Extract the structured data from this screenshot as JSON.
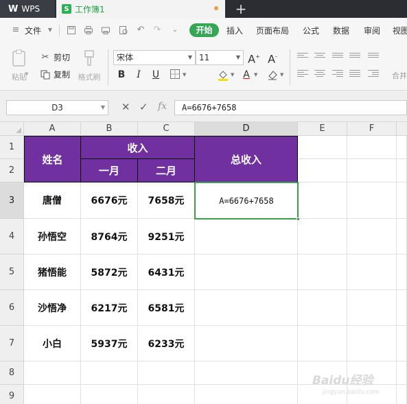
{
  "tabs": {
    "wps_label": "WPS",
    "wps_logo": "W",
    "doc_icon": "S",
    "doc_title": "工作簿1",
    "new_tab": "+"
  },
  "menu": {
    "file": "文件",
    "start": "开始",
    "insert": "插入",
    "page_layout": "页面布局",
    "formulas": "公式",
    "data": "数据",
    "review": "审阅",
    "view": "视图"
  },
  "ribbon": {
    "paste": "粘贴",
    "cut": "剪切",
    "copy": "复制",
    "format_painter": "格式刷",
    "font_name": "宋体",
    "font_size": "11",
    "merge_center": "合并居中"
  },
  "formula_bar": {
    "name_box": "D3",
    "fx": "fx",
    "formula": "A=6676+7658"
  },
  "columns": [
    "A",
    "B",
    "C",
    "D",
    "E",
    "F"
  ],
  "rows": [
    "1",
    "2",
    "3",
    "4",
    "5",
    "6",
    "7",
    "8",
    "9"
  ],
  "table": {
    "header_name": "姓名",
    "header_income": "收入",
    "header_jan": "一月",
    "header_feb": "二月",
    "header_total": "总收入",
    "records": [
      {
        "name": "唐僧",
        "jan": "6676元",
        "feb": "7658元"
      },
      {
        "name": "孙悟空",
        "jan": "8764元",
        "feb": "9251元"
      },
      {
        "name": "猪悟能",
        "jan": "5872元",
        "feb": "6431元"
      },
      {
        "name": "沙悟净",
        "jan": "6217元",
        "feb": "6581元"
      },
      {
        "name": "小白",
        "jan": "5937元",
        "feb": "6233元"
      }
    ],
    "active_cell_text": "A=6676+7658"
  },
  "selection": {
    "column": "D",
    "row": "3"
  },
  "colors": {
    "header_fill": "#7030a0",
    "accent_green": "#36a656",
    "tabbar_bg": "#2b2d33"
  },
  "watermark": {
    "brand": "Baidu经验",
    "url": "jingyan.baidu.com"
  },
  "icons": [
    "save-icon",
    "print-icon",
    "print-preview-icon",
    "undo-icon",
    "redo-icon",
    "cut-icon",
    "copy-icon",
    "paste-icon",
    "format-painter-icon",
    "bold-icon",
    "italic-icon",
    "underline-icon",
    "border-icon",
    "fill-color-icon",
    "font-color-icon",
    "clear-icon",
    "cancel-icon",
    "confirm-icon"
  ]
}
